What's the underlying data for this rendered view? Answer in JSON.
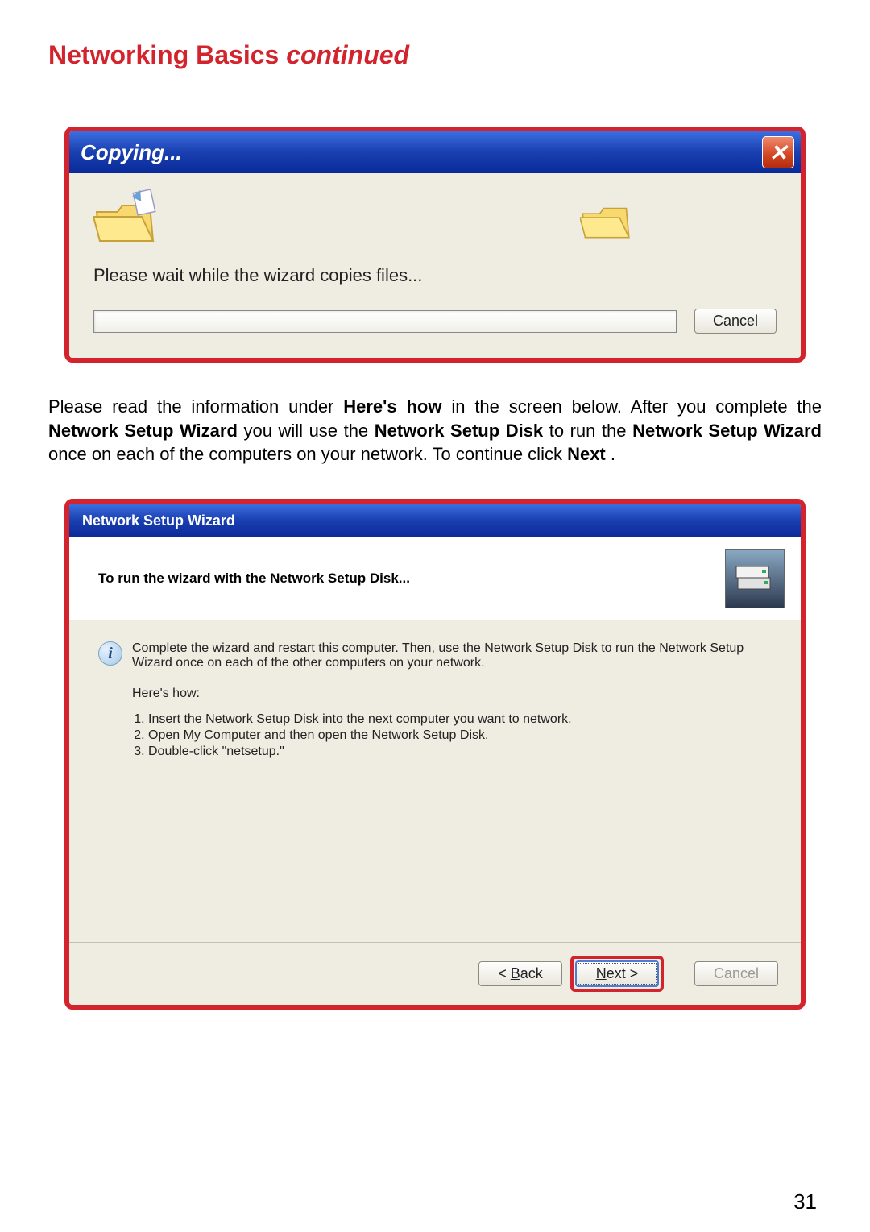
{
  "page": {
    "heading_plain": "Networking Basics",
    "heading_em": "continued",
    "number": "31"
  },
  "copying_dialog": {
    "title": "Copying...",
    "close_icon_glyph": "✕",
    "wait_text": "Please wait while the wizard copies files...",
    "cancel_label": "Cancel"
  },
  "instruction_paragraph": {
    "t1": "Please read the information under ",
    "b1": "Here's how",
    "t2": " in the screen below. After you complete the ",
    "b2": "Network Setup Wizard",
    "t3": " you will use the ",
    "b3": "Network Setup Disk",
    "t4": " to run the ",
    "b4": "Network Setup Wizard",
    "t5": " once on each of the computers on your network. To continue click ",
    "b5": "Next",
    "t6": "."
  },
  "wizard_dialog": {
    "title": "Network Setup Wizard",
    "header_text": "To run the wizard with the Network Setup Disk...",
    "info_para": "Complete the wizard and restart this computer. Then, use the Network Setup Disk to run the Network Setup Wizard once on each of the other computers on your network.",
    "heres_how_label": "Here's how:",
    "steps": [
      "Insert the Network Setup Disk into the next computer you want to network.",
      "Open My Computer and then open the Network Setup Disk.",
      "Double-click \"netsetup.\""
    ],
    "back_label": "< Back",
    "next_label": "Next >",
    "next_underline_char": "N",
    "back_underline_char": "B",
    "cancel_label": "Cancel"
  }
}
